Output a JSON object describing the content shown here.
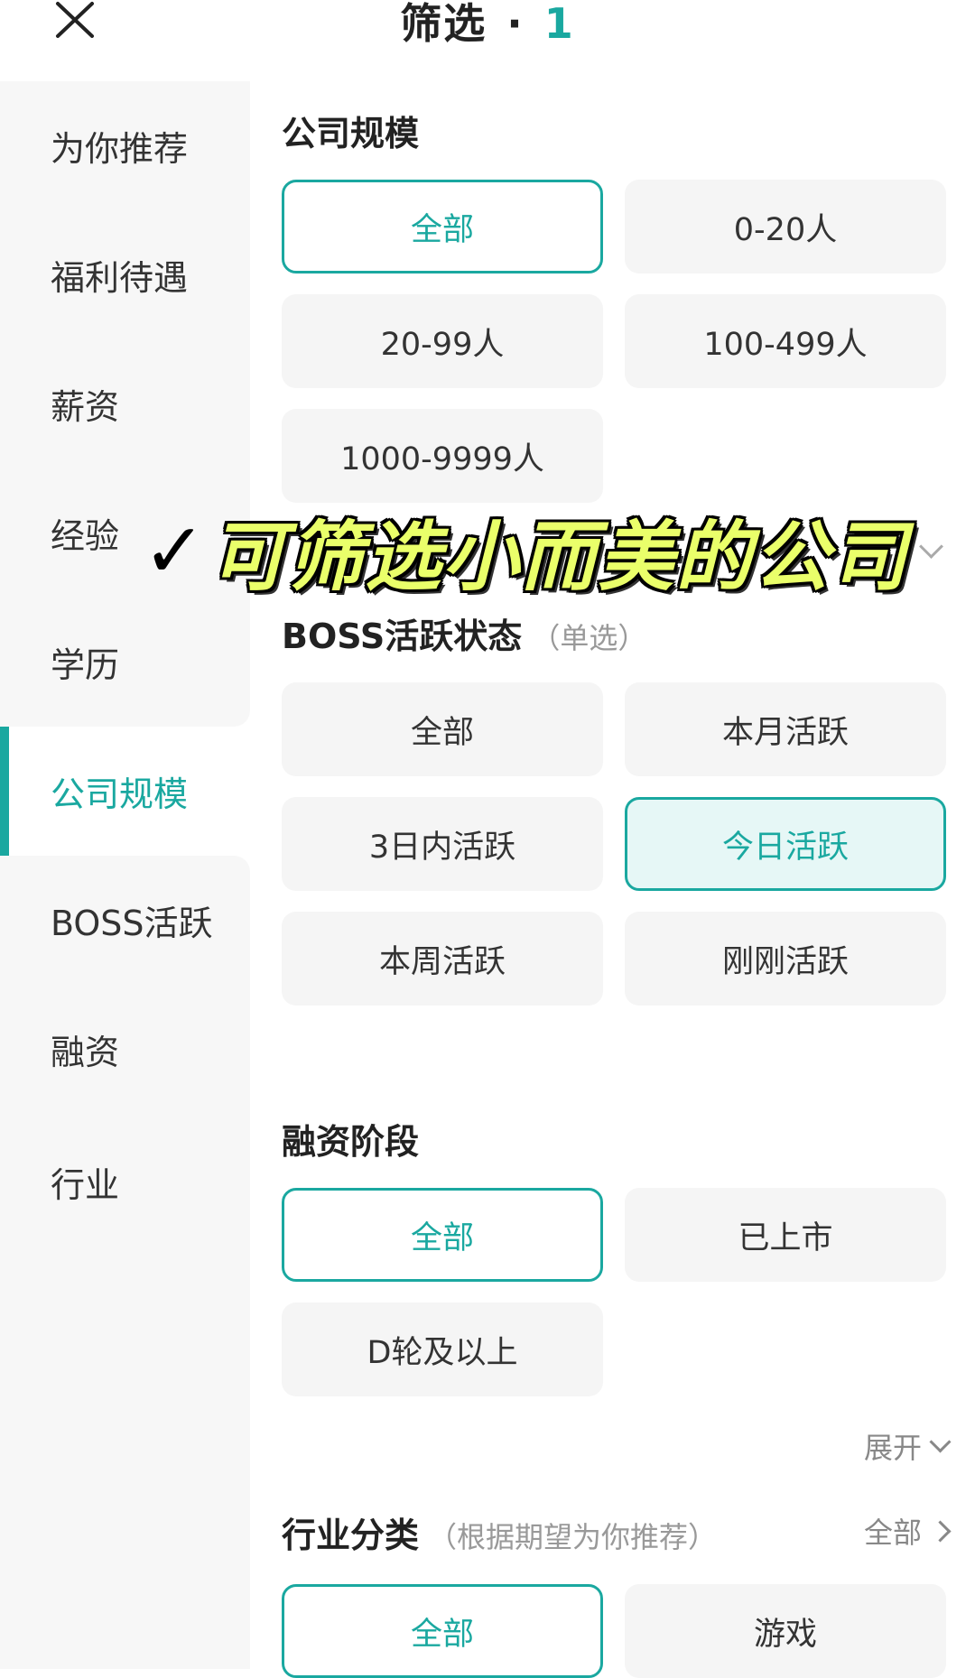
{
  "header": {
    "title": "筛选",
    "separator": "·",
    "count": "1"
  },
  "sidebar": {
    "items": [
      {
        "label": "为你推荐"
      },
      {
        "label": "福利待遇"
      },
      {
        "label": "薪资"
      },
      {
        "label": "经验"
      },
      {
        "label": "学历"
      },
      {
        "label": "公司规模"
      },
      {
        "label": "BOSS活跃"
      },
      {
        "label": "融资"
      },
      {
        "label": "行业"
      }
    ],
    "active_index": 5
  },
  "company_size": {
    "title": "公司规模",
    "options": [
      "全部",
      "0-20人",
      "20-99人",
      "100-499人",
      "1000-9999人"
    ],
    "selected": "全部"
  },
  "boss_active": {
    "title": "BOSS活跃状态",
    "subtitle": "（单选）",
    "options": [
      "全部",
      "本月活跃",
      "3日内活跃",
      "今日活跃",
      "本周活跃",
      "刚刚活跃"
    ],
    "selected": "今日活跃"
  },
  "financing": {
    "title": "融资阶段",
    "options": [
      "全部",
      "已上市",
      "D轮及以上"
    ],
    "selected": "全部",
    "expand_label": "展开"
  },
  "industry": {
    "title": "行业分类",
    "subtitle": "（根据期望为你推荐）",
    "all_label": "全部",
    "options": [
      "全部",
      "游戏"
    ],
    "selected": "全部"
  },
  "overlay": {
    "check": "✓",
    "caption": "可筛选小而美的公司"
  },
  "colors": {
    "accent": "#1aa8a0",
    "option_bg": "#f5f5f5",
    "sidebar_bg": "#f7f7f7",
    "caption": "#eaff6a"
  }
}
